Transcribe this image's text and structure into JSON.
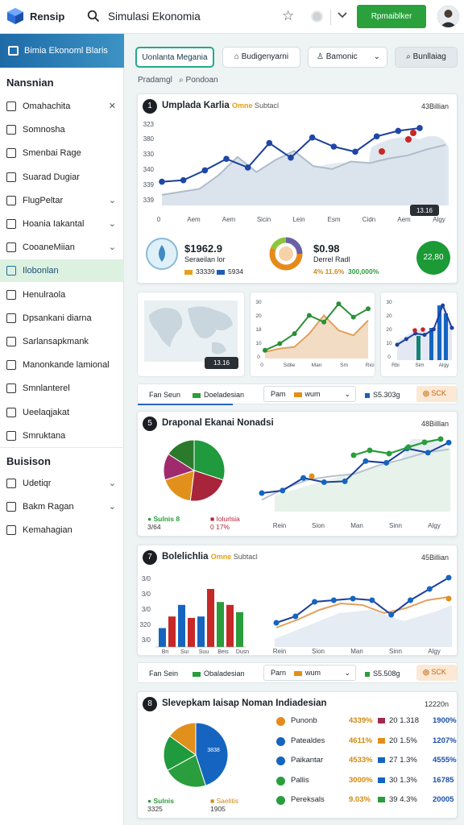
{
  "topbar": {
    "brand": "Rensip",
    "search": "Simulasi Ekonomia",
    "primary_button": "Rpmaiblker"
  },
  "sidebar": {
    "header": "Bimia Ekonoml Blaris",
    "section1": "Nansnian",
    "items1": [
      {
        "label": "Omahachita",
        "right": "✕"
      },
      {
        "label": "Somnosha",
        "right": ""
      },
      {
        "label": "Smenbai Rage",
        "right": ""
      },
      {
        "label": "Suarad Dugiar",
        "right": ""
      },
      {
        "label": "FlugPeltar",
        "right": "⌄"
      },
      {
        "label": "Hoania Iakantal",
        "right": "⌄"
      },
      {
        "label": "CooaneMiian",
        "right": "⌄"
      },
      {
        "label": "Ilobonlan",
        "right": ""
      },
      {
        "label": "Henulraola",
        "right": ""
      },
      {
        "label": "Dpsankani diarna",
        "right": ""
      },
      {
        "label": "Sarlansapkmank",
        "right": ""
      },
      {
        "label": "Manonkande lamional",
        "right": ""
      },
      {
        "label": "Smnlanterel",
        "right": ""
      },
      {
        "label": "Ueelaqjakat",
        "right": ""
      },
      {
        "label": "Smruktana",
        "right": ""
      }
    ],
    "section2": "Buisison",
    "items2": [
      {
        "label": "Udetiqr",
        "right": "⌄"
      },
      {
        "label": "Bakm Ragan",
        "right": "⌄"
      },
      {
        "label": "Kemahagian",
        "right": ""
      }
    ]
  },
  "toolbar": {
    "btn1": "Uonlanta Megania",
    "btn2": "Budigenyarni",
    "btn3": "Bamonic",
    "btn4": "Bunllaiag"
  },
  "crumbs": {
    "a": "Pradamgl",
    "b": "Pondoan"
  },
  "card1": {
    "num": "1",
    "title": "Umplada Karlia",
    "sub_em": "Omne",
    "sub": "Subtacl",
    "right": "43Billian",
    "yticks": [
      "323",
      "380",
      "330",
      "340",
      "339",
      "339"
    ],
    "xticks": [
      "0",
      "Aem",
      "Aem",
      "Sicin",
      "Lein",
      "Esm",
      "Cidn",
      "Aem",
      "Algy"
    ],
    "tag": "13.16",
    "stat1_value": "$1962.9",
    "stat1_label": "Seraeilan lor",
    "stat1_a": "33339",
    "stat1_b": "5934",
    "stat2_value": "$0.98",
    "stat2_label": "Derrel Radl",
    "stat2_a": "4% 11.6%",
    "stat2_b": "300,000%",
    "stat3_value": "22,80"
  },
  "chart_data": [
    {
      "type": "line",
      "title": "Umplada Karlia",
      "categories": [
        "Aem",
        "Aem",
        "Sicin",
        "Lein",
        "Esm",
        "Cidn",
        "Aem",
        "Algy"
      ],
      "series": [
        {
          "values": [
            60,
            64,
            89,
            118,
            96,
            158,
            121,
            172,
            149,
            136,
            175,
            189,
            196
          ]
        }
      ],
      "ylim": [
        0,
        200
      ]
    },
    {
      "type": "line",
      "title": "Draponal Ekanai Nonadsi",
      "categories": [
        "Rein",
        "Sion",
        "Man",
        "Sinn",
        "Algy"
      ],
      "series": [
        {
          "values": [
            22,
            25,
            40,
            35,
            36,
            60,
            58,
            75,
            70,
            82
          ]
        },
        {
          "values": [
            14,
            28,
            38,
            42,
            45,
            55,
            62,
            70,
            74
          ]
        }
      ]
    },
    {
      "type": "bar",
      "title": "Bolelichlia",
      "categories": [
        "Bri",
        "Sui",
        "Suu",
        "Beis",
        "Dusn"
      ],
      "series": [
        {
          "values": [
            26,
            58,
            42,
            68,
            48
          ]
        },
        {
          "values": [
            42,
            40,
            80,
            58,
            70
          ]
        },
        {
          "values": [
            24,
            36,
            55,
            62,
            48
          ]
        }
      ]
    },
    {
      "type": "pie",
      "title": "Slevepkam Iaisap Noman Indiadesian",
      "values": [
        45,
        22,
        18,
        15
      ]
    }
  ],
  "mini": {
    "tag": "13.16",
    "xticks": [
      "0",
      "Sdile",
      "Man",
      "Sm",
      "Ricin"
    ],
    "xticks2": [
      "Rbi",
      "Sim",
      "Algy"
    ]
  },
  "filter1": {
    "a": "Fan Seun",
    "b": "Doeladesian",
    "c": "Pam",
    "d": "wum",
    "e": "S5.303g",
    "f": "SCK"
  },
  "card2": {
    "num": "5",
    "title": "Draponal Ekanai Nonadsi",
    "right": "48Billlan",
    "legend_a": "Sulnis 8",
    "legend_a_val": "3/64",
    "legend_b": "Iolurlsia",
    "legend_b_val": "0 17%",
    "xticks": [
      "Rein",
      "Sion",
      "Man",
      "Sinn",
      "Algy"
    ]
  },
  "card3": {
    "num": "7",
    "title": "Bolelichlia",
    "sub_em": "Omne",
    "sub": "Subtacl",
    "right": "45Billian",
    "yticks": [
      "3/0",
      "3/0",
      "3/0",
      "320",
      "3/0"
    ],
    "xticks": [
      "Bri",
      "Sui",
      "Suu",
      "Beis",
      "Dusn"
    ],
    "xticks2": [
      "Rein",
      "Sion",
      "Man",
      "Sinn",
      "Algy"
    ]
  },
  "filter2": {
    "a": "Fan Sein",
    "b": "Obaladesian",
    "c": "Parn",
    "d": "wum",
    "e": "S5.508g",
    "f": "SCK"
  },
  "card4": {
    "num": "8",
    "title": "Slevepkam Iaisap Noman Indiadesian",
    "right": "12220n",
    "pie_label": "3838",
    "legend_a": "Sulnis",
    "legend_a_val": "3325",
    "legend_b": "Saelitis",
    "legend_b_val": "1905",
    "rows": [
      {
        "name": "Punonb",
        "v1": "4339%",
        "v2": "20 1.318",
        "v3": "1900%",
        "c": "#e58a1b"
      },
      {
        "name": "Patealdes",
        "v1": "4611%",
        "v2": "20 1.5%",
        "v3": "1207%",
        "c": "#1565c0"
      },
      {
        "name": "Paikantar",
        "v1": "4533%",
        "v2": "27 1.3%",
        "v3": "4555%",
        "c": "#1565c0"
      },
      {
        "name": "Pallis",
        "v1": "3000%",
        "v2": "30 1.3%",
        "v3": "16785",
        "c": "#2a9d3c"
      },
      {
        "name": "Pereksals",
        "v1": "9.03%",
        "v2": "39 4.3%",
        "v3": "20005",
        "c": "#2a9d3c"
      }
    ]
  }
}
